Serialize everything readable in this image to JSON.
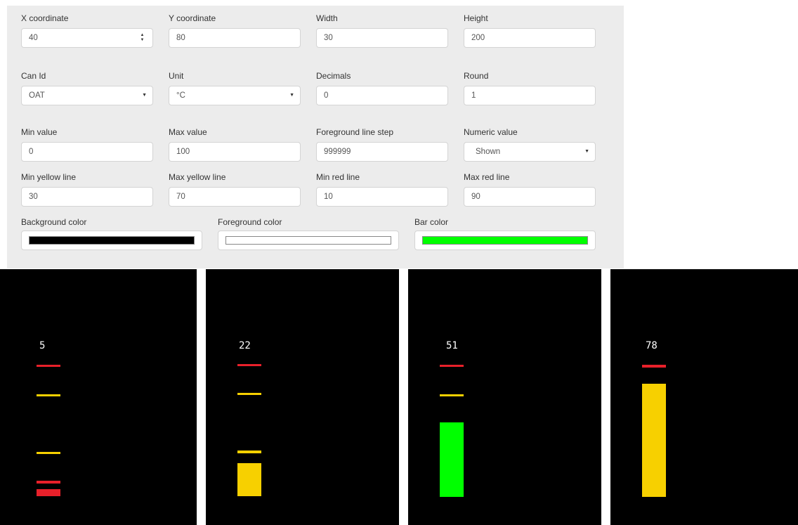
{
  "form": {
    "x_coordinate": {
      "label": "X coordinate",
      "value": "40"
    },
    "y_coordinate": {
      "label": "Y coordinate",
      "value": "80"
    },
    "width": {
      "label": "Width",
      "value": "30"
    },
    "height": {
      "label": "Height",
      "value": "200"
    },
    "can_id": {
      "label": "Can Id",
      "value": "OAT"
    },
    "unit": {
      "label": "Unit",
      "value": "°C"
    },
    "decimals": {
      "label": "Decimals",
      "value": "0"
    },
    "round": {
      "label": "Round",
      "value": "1"
    },
    "min_value": {
      "label": "Min value",
      "value": "0"
    },
    "max_value": {
      "label": "Max value",
      "value": "100"
    },
    "foreground_line_step": {
      "label": "Foreground line step",
      "value": "999999"
    },
    "numeric_value": {
      "label": "Numeric value",
      "value": "Shown"
    },
    "min_yellow_line": {
      "label": "Min yellow line",
      "value": "30"
    },
    "max_yellow_line": {
      "label": "Max yellow line",
      "value": "70"
    },
    "min_red_line": {
      "label": "Min red line",
      "value": "10"
    },
    "max_red_line": {
      "label": "Max red line",
      "value": "90"
    },
    "background_color": {
      "label": "Background color",
      "color": "#000000"
    },
    "foreground_color": {
      "label": "Foreground color",
      "color": "#ffffff"
    },
    "bar_color": {
      "label": "Bar color",
      "color": "#00ff00"
    }
  },
  "colors": {
    "red_line": "#e8202a",
    "yellow_line": "#f7d000",
    "yellow_bar": "#f7d000",
    "red_bar": "#e8202a",
    "green_bar": "#00ff00",
    "value_text": "#ffffff"
  },
  "previews": [
    {
      "value": "5"
    },
    {
      "value": "22"
    },
    {
      "value": "51"
    },
    {
      "value": "78"
    }
  ]
}
